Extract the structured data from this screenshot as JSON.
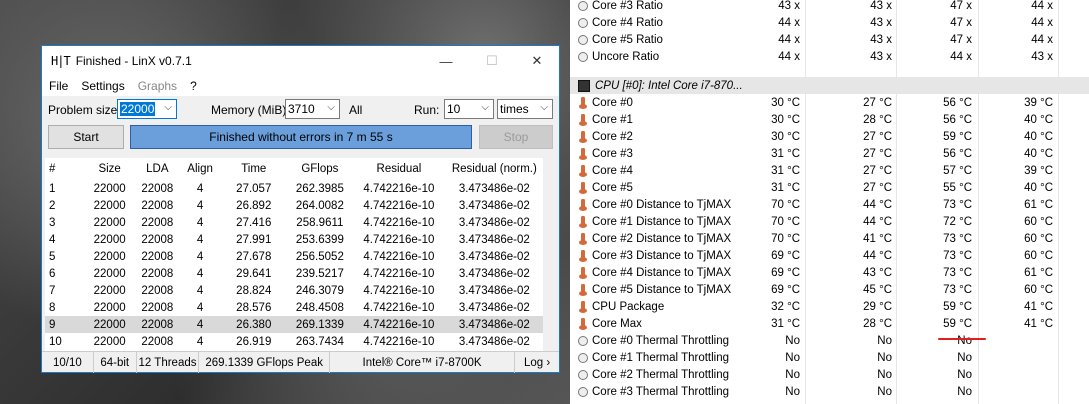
{
  "window": {
    "logo": "H|T",
    "title": "Finished - LinX v0.7.1",
    "controls": {
      "minimize": "—",
      "maximize": "☐",
      "close": "✕"
    }
  },
  "menu": [
    "File",
    "Settings",
    "Graphs",
    "?"
  ],
  "toolbar": {
    "problem_size_label": "Problem size:",
    "problem_size_value": "22000",
    "memory_label": "Memory (MiB):",
    "memory_value": "3710",
    "all_label": "All",
    "run_label": "Run:",
    "run_value": "10",
    "run_unit": "times",
    "start_label": "Start",
    "stop_label": "Stop",
    "progress_text": "Finished without errors in 7 m 55 s"
  },
  "table": {
    "headers": [
      "#",
      "Size",
      "LDA",
      "Align",
      "Time",
      "GFlops",
      "Residual",
      "Residual (norm.)"
    ],
    "rows": [
      [
        "1",
        "22000",
        "22008",
        "4",
        "27.057",
        "262.3985",
        "4.742216e-10",
        "3.473486e-02"
      ],
      [
        "2",
        "22000",
        "22008",
        "4",
        "26.892",
        "264.0082",
        "4.742216e-10",
        "3.473486e-02"
      ],
      [
        "3",
        "22000",
        "22008",
        "4",
        "27.416",
        "258.9611",
        "4.742216e-10",
        "3.473486e-02"
      ],
      [
        "4",
        "22000",
        "22008",
        "4",
        "27.991",
        "253.6399",
        "4.742216e-10",
        "3.473486e-02"
      ],
      [
        "5",
        "22000",
        "22008",
        "4",
        "27.678",
        "256.5052",
        "4.742216e-10",
        "3.473486e-02"
      ],
      [
        "6",
        "22000",
        "22008",
        "4",
        "29.641",
        "239.5217",
        "4.742216e-10",
        "3.473486e-02"
      ],
      [
        "7",
        "22000",
        "22008",
        "4",
        "28.824",
        "246.3079",
        "4.742216e-10",
        "3.473486e-02"
      ],
      [
        "8",
        "22000",
        "22008",
        "4",
        "28.576",
        "248.4508",
        "4.742216e-10",
        "3.473486e-02"
      ],
      [
        "9",
        "22000",
        "22008",
        "4",
        "26.380",
        "269.1339",
        "4.742216e-10",
        "3.473486e-02"
      ],
      [
        "10",
        "22000",
        "22008",
        "4",
        "26.919",
        "263.7434",
        "4.742216e-10",
        "3.473486e-02"
      ]
    ],
    "selected_row": "9"
  },
  "status": {
    "runs": "10/10",
    "bits": "64-bit",
    "threads": "12 Threads",
    "peak": "269.1339 GFlops Peak",
    "cpu": "Intel® Core™ i7-8700K",
    "log": "Log ›"
  },
  "sensors": {
    "top_rows": [
      {
        "icon": "circle",
        "name": "Core #3 Ratio",
        "v": [
          "43 x",
          "43 x",
          "47 x",
          "44 x"
        ]
      },
      {
        "icon": "circle",
        "name": "Core #4 Ratio",
        "v": [
          "44 x",
          "43 x",
          "47 x",
          "44 x"
        ]
      },
      {
        "icon": "circle",
        "name": "Core #5 Ratio",
        "v": [
          "44 x",
          "43 x",
          "47 x",
          "44 x"
        ]
      },
      {
        "icon": "circle",
        "name": "Uncore Ratio",
        "v": [
          "44 x",
          "43 x",
          "44 x",
          "43 x"
        ]
      }
    ],
    "category": "CPU [#0]: Intel Core i7-870...",
    "rows": [
      {
        "icon": "therm",
        "name": "Core #0",
        "v": [
          "30 °C",
          "27 °C",
          "56 °C",
          "39 °C"
        ]
      },
      {
        "icon": "therm",
        "name": "Core #1",
        "v": [
          "30 °C",
          "28 °C",
          "56 °C",
          "40 °C"
        ]
      },
      {
        "icon": "therm",
        "name": "Core #2",
        "v": [
          "30 °C",
          "27 °C",
          "59 °C",
          "40 °C"
        ]
      },
      {
        "icon": "therm",
        "name": "Core #3",
        "v": [
          "31 °C",
          "27 °C",
          "56 °C",
          "40 °C"
        ]
      },
      {
        "icon": "therm",
        "name": "Core #4",
        "v": [
          "31 °C",
          "27 °C",
          "57 °C",
          "39 °C"
        ]
      },
      {
        "icon": "therm",
        "name": "Core #5",
        "v": [
          "31 °C",
          "27 °C",
          "55 °C",
          "40 °C"
        ]
      },
      {
        "icon": "therm",
        "name": "Core #0 Distance to TjMAX",
        "v": [
          "70 °C",
          "44 °C",
          "73 °C",
          "61 °C"
        ]
      },
      {
        "icon": "therm",
        "name": "Core #1 Distance to TjMAX",
        "v": [
          "70 °C",
          "44 °C",
          "72 °C",
          "60 °C"
        ]
      },
      {
        "icon": "therm",
        "name": "Core #2 Distance to TjMAX",
        "v": [
          "70 °C",
          "41 °C",
          "73 °C",
          "60 °C"
        ]
      },
      {
        "icon": "therm",
        "name": "Core #3 Distance to TjMAX",
        "v": [
          "69 °C",
          "44 °C",
          "73 °C",
          "60 °C"
        ]
      },
      {
        "icon": "therm",
        "name": "Core #4 Distance to TjMAX",
        "v": [
          "69 °C",
          "43 °C",
          "73 °C",
          "61 °C"
        ]
      },
      {
        "icon": "therm",
        "name": "Core #5 Distance to TjMAX",
        "v": [
          "69 °C",
          "45 °C",
          "73 °C",
          "60 °C"
        ]
      },
      {
        "icon": "therm",
        "name": "CPU Package",
        "v": [
          "32 °C",
          "29 °C",
          "59 °C",
          "41 °C"
        ]
      },
      {
        "icon": "therm",
        "name": "Core Max",
        "v": [
          "31 °C",
          "28 °C",
          "59 °C",
          "41 °C"
        ]
      },
      {
        "icon": "circle",
        "name": "Core #0 Thermal Throttling",
        "v": [
          "No",
          "No",
          "No",
          ""
        ]
      },
      {
        "icon": "circle",
        "name": "Core #1 Thermal Throttling",
        "v": [
          "No",
          "No",
          "No",
          ""
        ]
      },
      {
        "icon": "circle",
        "name": "Core #2 Thermal Throttling",
        "v": [
          "No",
          "No",
          "No",
          ""
        ]
      },
      {
        "icon": "circle",
        "name": "Core #3 Thermal Throttling",
        "v": [
          "No",
          "No",
          "No",
          ""
        ]
      }
    ]
  },
  "colors": {
    "accent": "#0078d7",
    "progress": "#6a9fdc",
    "highlight": "#e02020"
  }
}
